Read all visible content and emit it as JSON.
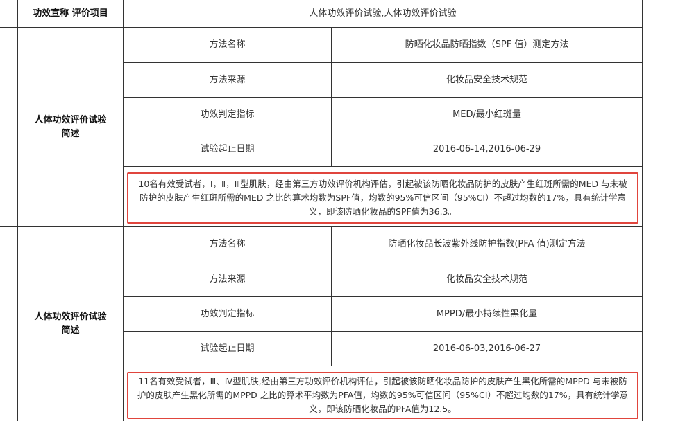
{
  "header": {
    "label": "功效宣称 评价项目",
    "value": "人体功效评价试验,人体功效评价试验"
  },
  "groups": [
    {
      "title": "人体功效评价试验简述",
      "rows": [
        {
          "label": "方法名称",
          "value": "防晒化妆品防晒指数（SPF 值）测定方法"
        },
        {
          "label": "方法来源",
          "value": "化妆品安全技术规范"
        },
        {
          "label": "功效判定指标",
          "value": "MED/最小红斑量"
        },
        {
          "label": "试验起止日期",
          "value": "2016-06-14,2016-06-29"
        }
      ],
      "summary": "10名有效受试者，Ⅰ，Ⅱ，Ⅲ型肌肤，经由第三方功效评价机构评估，引起被该防晒化妆品防护的皮肤产生红斑所需的MED 与未被防护的皮肤产生红斑所需的MED 之比的算术均数为SPF值，均数的95%可信区间（95%CI）不超过均数的17%，具有统计学意义，即该防晒化妆品的SPF值为36.3。"
    },
    {
      "title": "人体功效评价试验简述",
      "rows": [
        {
          "label": "方法名称",
          "value": "防晒化妆品长波紫外线防护指数(PFA 值)测定方法"
        },
        {
          "label": "方法来源",
          "value": "化妆品安全技术规范"
        },
        {
          "label": "功效判定指标",
          "value": "MPPD/最小持续性黑化量"
        },
        {
          "label": "试验起止日期",
          "value": "2016-06-03,2016-06-27"
        }
      ],
      "summary": "11名有效受试者，Ⅲ、Ⅳ型肌肤,经由第三方功效评价机构评估，引起被该防晒化妆品防护的皮肤产生黑化所需的MPPD 与未被防护的皮肤产生黑化所需的MPPD 之比的算术平均数为PFA值，均数的95%可信区间（95%CI）不超过均数的17%，具有统计学意义，即该防晒化妆品的PFA值为12.5。"
    }
  ]
}
